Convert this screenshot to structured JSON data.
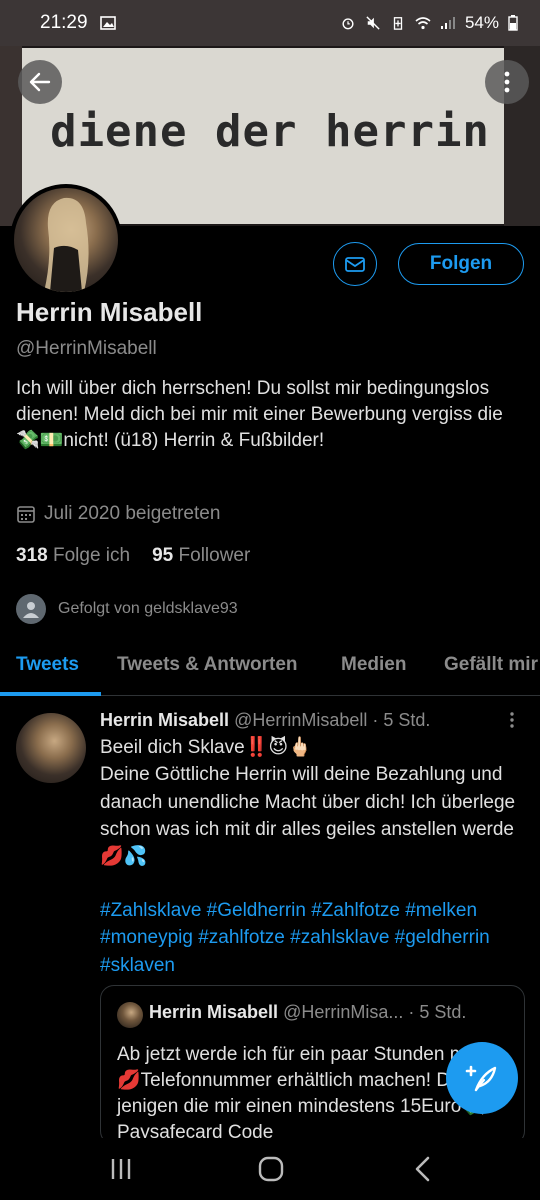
{
  "status_bar": {
    "time": "21:29",
    "battery": "54%",
    "icons": [
      "gallery-icon",
      "alarm-icon",
      "mute-icon",
      "battery-saver-icon",
      "wifi-icon",
      "signal-icon",
      "battery-icon"
    ]
  },
  "banner": {
    "text": "diene der herrin"
  },
  "profile": {
    "name": "Herrin Misabell",
    "handle": "@HerrinMisabell",
    "bio": "Ich will über dich herrschen! Du sollst mir bedingungslos dienen! Meld dich bei mir mit einer Bewerbung vergiss die💸💵nicht! (ü18) Herrin & Fußbilder!",
    "joined": "Juli 2020 beigetreten",
    "following_count": "318",
    "following_label": "Folge ich",
    "followers_count": "95",
    "followers_label": "Follower",
    "followed_by": "Gefolgt von geldsklave93",
    "follow_button": "Folgen"
  },
  "tabs": [
    {
      "label": "Tweets",
      "active": true
    },
    {
      "label": "Tweets & Antworten",
      "active": false
    },
    {
      "label": "Medien",
      "active": false
    },
    {
      "label": "Gefällt mir",
      "active": false
    }
  ],
  "tweet": {
    "name": "Herrin Misabell",
    "meta": "@HerrinMisabell · 5 Std.",
    "line1": "Beeil dich Sklave‼️😈🖕🏻",
    "line2": "Deine Göttliche Herrin will deine Bezahlung und danach unendliche Macht über dich! Ich überlege schon was ich mit dir alles geiles anstellen werde 💋💦",
    "hashtags": "#Zahlsklave #Geldherrin #Zahlfotze #melken #moneypig #zahlfotze #zahlsklave #geldherrin #sklaven"
  },
  "quote": {
    "name": "Herrin Misabell",
    "meta": "@HerrinMisa... · 5 Std.",
    "body": "Ab jetzt werde ich für ein paar Stunden meine💋Telefonnummer erhältlich machen! Die jenigen die mir einen mindestens 15Euro💸Paysafecard Code"
  },
  "colors": {
    "accent": "#1d9bf0",
    "background": "#000000",
    "secondary_text": "#8b8b8b"
  }
}
